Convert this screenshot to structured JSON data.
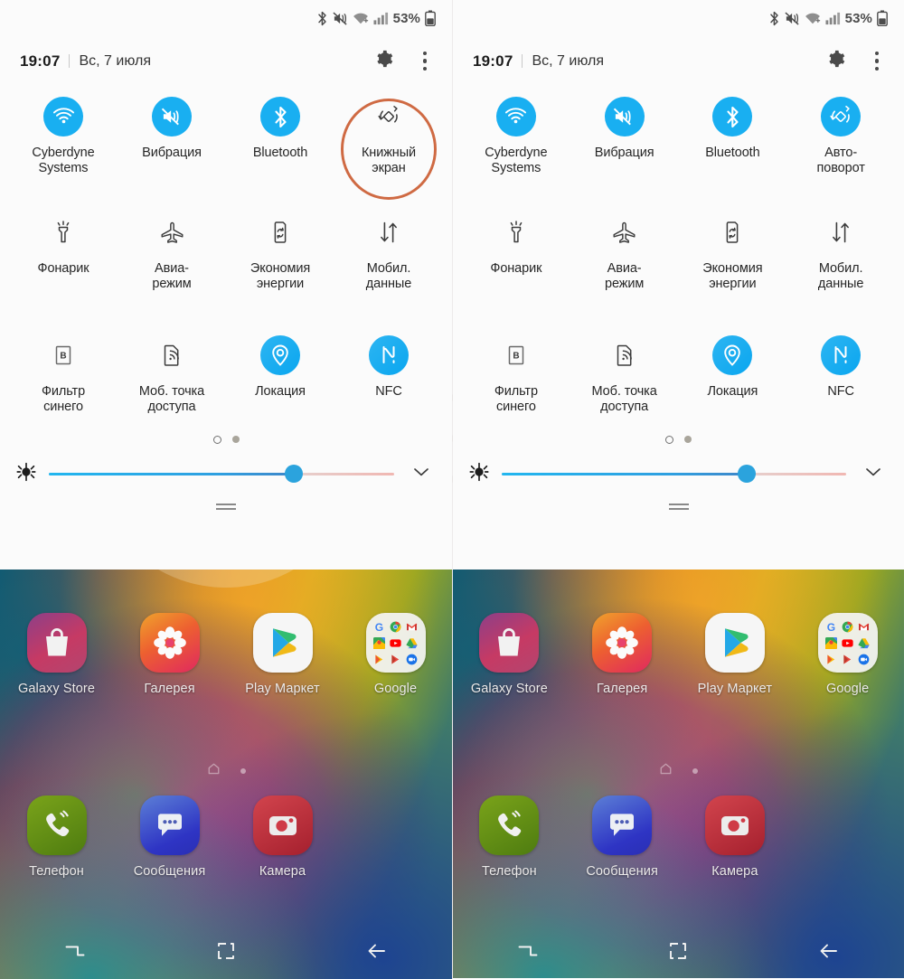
{
  "meta": {
    "accent_blue": "#19aff1",
    "highlight_ring": "#cf6a43",
    "panel_bg": "#fbfbfb"
  },
  "statusbar": {
    "icons": [
      "bluetooth-icon",
      "mute-vibrate-icon",
      "wifi-icon",
      "signal-icon"
    ],
    "battery_percent": "53%",
    "battery_icon": "battery-icon"
  },
  "panel_header": {
    "time": "19:07",
    "date": "Вс, 7 июля",
    "settings_icon": "gear-icon",
    "more_icon": "more-vertical-icon"
  },
  "left_panel": {
    "rows": [
      [
        {
          "label": "Cyberdyne\nSystems",
          "icon": "wifi-icon",
          "state": "on",
          "highlight": false
        },
        {
          "label": "Вибрация",
          "icon": "vibrate-icon",
          "state": "on",
          "highlight": false
        },
        {
          "label": "Bluetooth",
          "icon": "bluetooth-icon",
          "state": "on",
          "highlight": false
        },
        {
          "label": "Книжный\nэкран",
          "icon": "rotation-lock-icon",
          "state": "off",
          "highlight": true
        }
      ],
      [
        {
          "label": "Фонарик",
          "icon": "flashlight-icon",
          "state": "off",
          "highlight": false
        },
        {
          "label": "Авиа-\nрежим",
          "icon": "airplane-icon",
          "state": "off",
          "highlight": false
        },
        {
          "label": "Экономия\nэнергии",
          "icon": "power-saving-icon",
          "state": "off",
          "highlight": false
        },
        {
          "label": "Мобил.\nданные",
          "icon": "mobile-data-icon",
          "state": "off",
          "highlight": false
        }
      ],
      [
        {
          "label": "Фильтр\nсинего",
          "icon": "blue-light-filter-icon",
          "state": "off",
          "highlight": false
        },
        {
          "label": "Моб. точка\nдоступа",
          "icon": "hotspot-icon",
          "state": "off",
          "highlight": false
        },
        {
          "label": "Локация",
          "icon": "location-icon",
          "state": "on",
          "highlight": false
        },
        {
          "label": "NFC",
          "icon": "nfc-icon",
          "state": "on",
          "highlight": false
        }
      ]
    ]
  },
  "right_panel": {
    "rows": [
      [
        {
          "label": "Cyberdyne\nSystems",
          "icon": "wifi-icon",
          "state": "on",
          "highlight": false
        },
        {
          "label": "Вибрация",
          "icon": "vibrate-icon",
          "state": "on",
          "highlight": false
        },
        {
          "label": "Bluetooth",
          "icon": "bluetooth-icon",
          "state": "on",
          "highlight": false
        },
        {
          "label": "Авто-\nповорот",
          "icon": "auto-rotate-icon",
          "state": "on",
          "highlight": false
        }
      ],
      [
        {
          "label": "Фонарик",
          "icon": "flashlight-icon",
          "state": "off",
          "highlight": false
        },
        {
          "label": "Авиа-\nрежим",
          "icon": "airplane-icon",
          "state": "off",
          "highlight": false
        },
        {
          "label": "Экономия\nэнергии",
          "icon": "power-saving-icon",
          "state": "off",
          "highlight": false
        },
        {
          "label": "Мобил.\nданные",
          "icon": "mobile-data-icon",
          "state": "off",
          "highlight": false
        }
      ],
      [
        {
          "label": "Фильтр\nсинего",
          "icon": "blue-light-filter-icon",
          "state": "off",
          "highlight": false
        },
        {
          "label": "Моб. точка\nдоступа",
          "icon": "hotspot-icon",
          "state": "off",
          "highlight": false
        },
        {
          "label": "Локация",
          "icon": "location-icon",
          "state": "on",
          "highlight": false
        },
        {
          "label": "NFC",
          "icon": "nfc-icon",
          "state": "on",
          "highlight": false
        }
      ]
    ]
  },
  "brightness": {
    "icon": "brightness-icon",
    "value_percent": 71,
    "expand_icon": "chevron-down-icon"
  },
  "page_indicator": {
    "pages": 2,
    "current": 1
  },
  "home_screen": {
    "row1": [
      {
        "label": "Galaxy Store",
        "icon": "galaxy-store-icon"
      },
      {
        "label": "Галерея",
        "icon": "gallery-icon"
      },
      {
        "label": "Play Маркет",
        "icon": "play-store-icon"
      },
      {
        "label": "Google",
        "icon": "google-folder-icon"
      }
    ],
    "row2": [
      {
        "label": "Телефон",
        "icon": "phone-icon"
      },
      {
        "label": "Сообщения",
        "icon": "messages-icon"
      },
      {
        "label": "Камера",
        "icon": "camera-icon"
      }
    ],
    "home_indicator_icon": "home-page-icon"
  },
  "navbar": {
    "recents_icon": "recents-icon",
    "home_icon": "home-icon",
    "back_icon": "back-arrow-icon"
  }
}
